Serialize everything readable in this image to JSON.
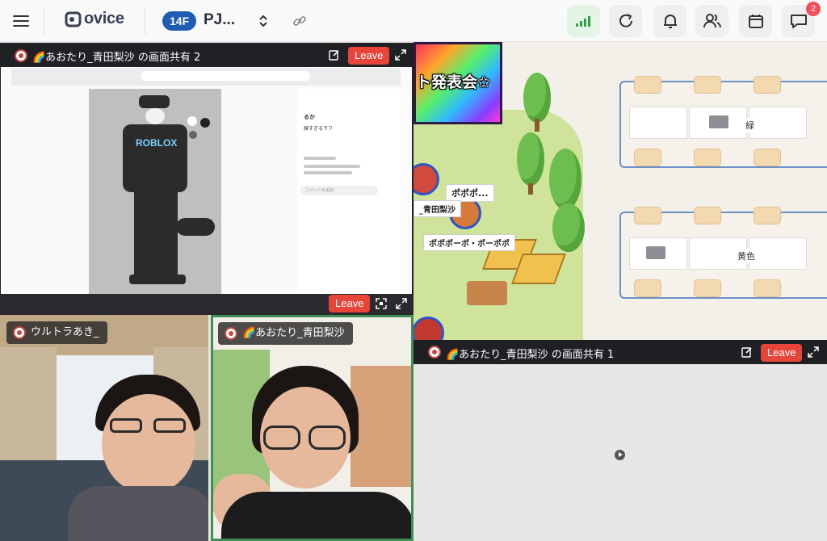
{
  "app": {
    "logo_text": "ovice",
    "floor": "14F",
    "space_name": "PJ...",
    "notifications_count": "2",
    "accent": "#1f5db5",
    "leave_color": "#e7443a"
  },
  "toolbar": {
    "icons": [
      "menu-icon",
      "chevron-updown-icon",
      "link-icon",
      "signal-icon",
      "refresh-icon",
      "bell-icon",
      "people-icon",
      "calendar-icon",
      "chat-icon"
    ]
  },
  "share2": {
    "title": "🌈あおたり_青田梨沙 の画面共有 2",
    "leave_label": "Leave"
  },
  "share1": {
    "title": "🌈あおたり_青田梨沙 の画面共有 1",
    "leave_label": "Leave"
  },
  "camera_bar": {
    "leave_label": "Leave"
  },
  "cams": [
    {
      "name": "ウルトラあき_"
    },
    {
      "name": "🌈あおたり_青田梨沙",
      "border_color": "#3f8f54"
    }
  ],
  "map": {
    "banner": "ト発表会✩",
    "clusters": [
      {
        "label": "緑"
      },
      {
        "label": "黄色"
      }
    ],
    "tags": {
      "popo_short": "ポポポ...",
      "aota": "_青田梨沙",
      "popo_full": "ポポポーポ・ポーポポ"
    }
  },
  "shared_screen": {
    "brand_text": "ROBLOX",
    "chat_name": "るか",
    "chat_msg": "線すぎるラフ",
    "comment_placeholder": "コメントを追加"
  }
}
